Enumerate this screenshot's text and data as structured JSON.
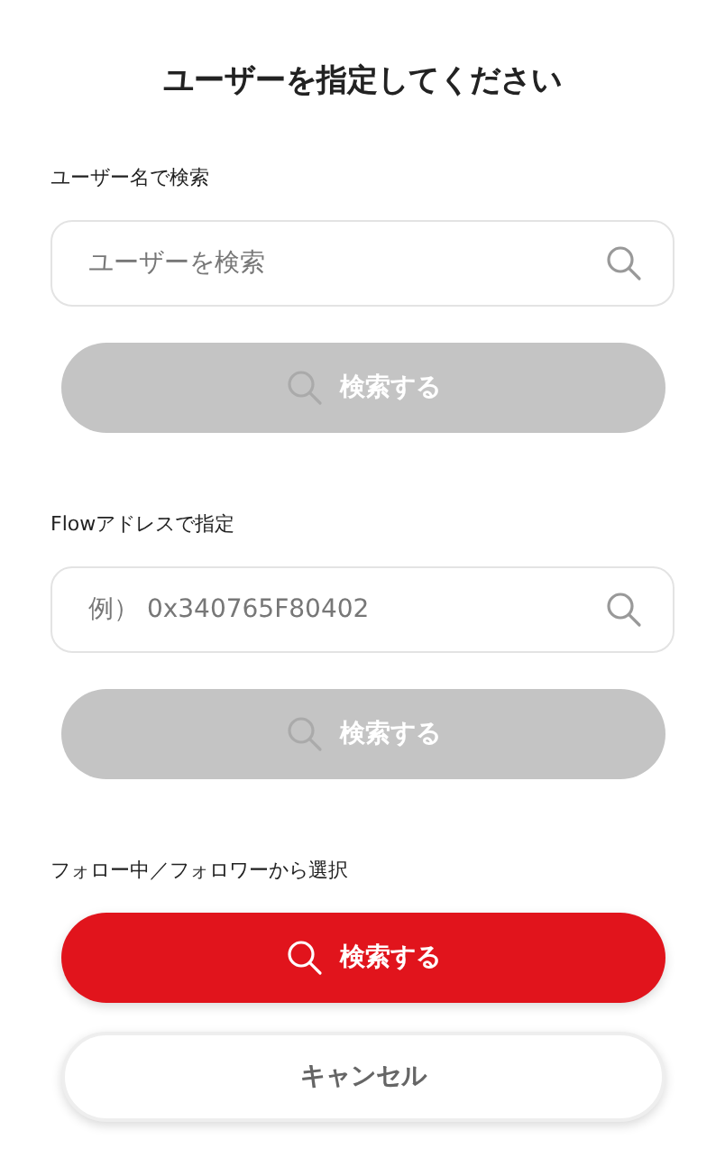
{
  "title": "ユーザーを指定してください",
  "sections": [
    {
      "label": "ユーザー名で検索",
      "field": {
        "placeholder": "ユーザーを検索"
      },
      "button": {
        "label": "検索する",
        "disabled": true
      }
    },
    {
      "label": "Flowアドレスで指定",
      "field": {
        "placeholder": "例） 0x340765F80402"
      },
      "button": {
        "label": "検索する",
        "disabled": true
      }
    },
    {
      "label": "フォロー中／フォロワーから選択",
      "button": {
        "label": "検索する",
        "disabled": false
      }
    }
  ],
  "cancel_button": {
    "label": "キャンセル"
  }
}
